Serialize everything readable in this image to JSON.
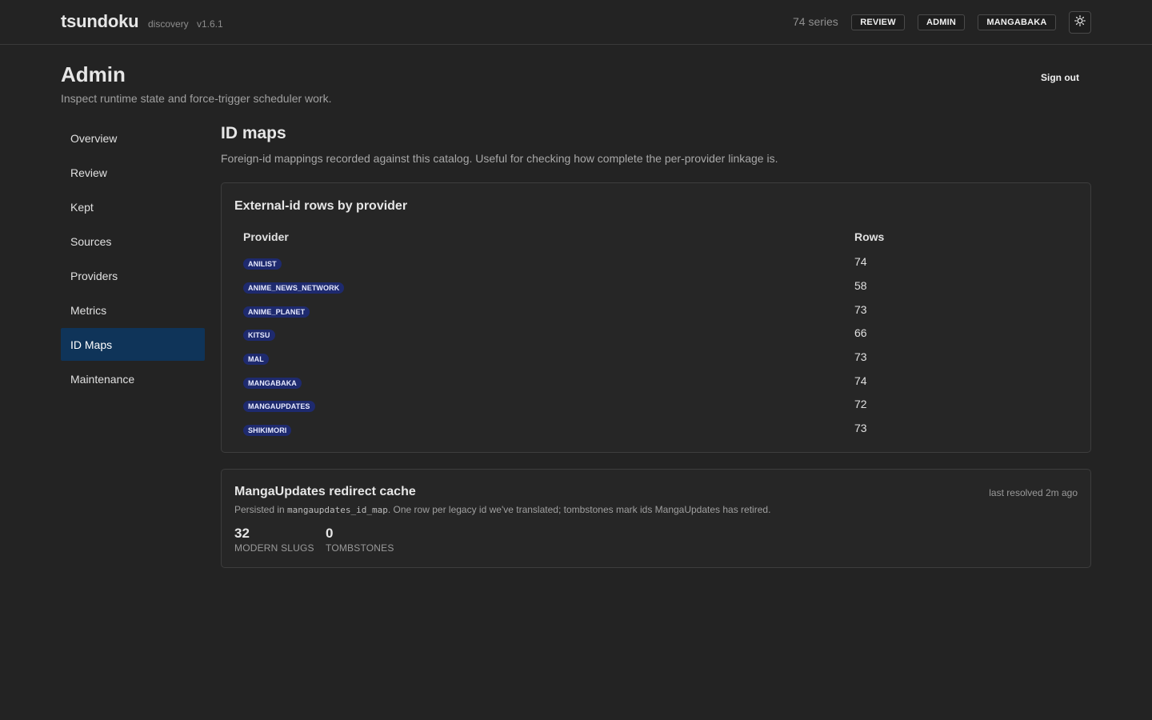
{
  "header": {
    "brand": "tsundoku",
    "subtitle": "discovery",
    "version": "v1.6.1",
    "series_count": "74 series",
    "nav": [
      "REVIEW",
      "ADMIN",
      "MANGABAKA"
    ],
    "theme_toggle_icon": "sun-icon"
  },
  "page": {
    "title": "Admin",
    "subtitle": "Inspect runtime state and force-trigger scheduler work.",
    "sign_out": "Sign out"
  },
  "sidebar": {
    "items": [
      {
        "label": "Overview",
        "active": false
      },
      {
        "label": "Review",
        "active": false
      },
      {
        "label": "Kept",
        "active": false
      },
      {
        "label": "Sources",
        "active": false
      },
      {
        "label": "Providers",
        "active": false
      },
      {
        "label": "Metrics",
        "active": false
      },
      {
        "label": "ID Maps",
        "active": true
      },
      {
        "label": "Maintenance",
        "active": false
      }
    ]
  },
  "main": {
    "title": "ID maps",
    "description": "Foreign-id mappings recorded against this catalog. Useful for checking how complete the per-provider linkage is.",
    "provider_table": {
      "title": "External-id rows by provider",
      "columns": [
        "Provider",
        "Rows"
      ],
      "rows": [
        {
          "provider": "ANILIST",
          "rows": "74"
        },
        {
          "provider": "ANIME_NEWS_NETWORK",
          "rows": "58"
        },
        {
          "provider": "ANIME_PLANET",
          "rows": "73"
        },
        {
          "provider": "KITSU",
          "rows": "66"
        },
        {
          "provider": "MAL",
          "rows": "73"
        },
        {
          "provider": "MANGABAKA",
          "rows": "74"
        },
        {
          "provider": "MANGAUPDATES",
          "rows": "72"
        },
        {
          "provider": "SHIKIMORI",
          "rows": "73"
        }
      ]
    },
    "redirect_cache": {
      "title": "MangaUpdates redirect cache",
      "last_resolved": "last resolved 2m ago",
      "desc_prefix": "Persisted in ",
      "desc_code": "mangaupdates_id_map",
      "desc_suffix": ". One row per legacy id we've translated; tombstones mark ids MangaUpdates has retired.",
      "stats": [
        {
          "value": "32",
          "label": "MODERN SLUGS"
        },
        {
          "value": "0",
          "label": "TOMBSTONES"
        }
      ]
    }
  },
  "colors": {
    "background": "#232323",
    "active_nav": "#0f3459",
    "badge": "#1e2a6e"
  }
}
